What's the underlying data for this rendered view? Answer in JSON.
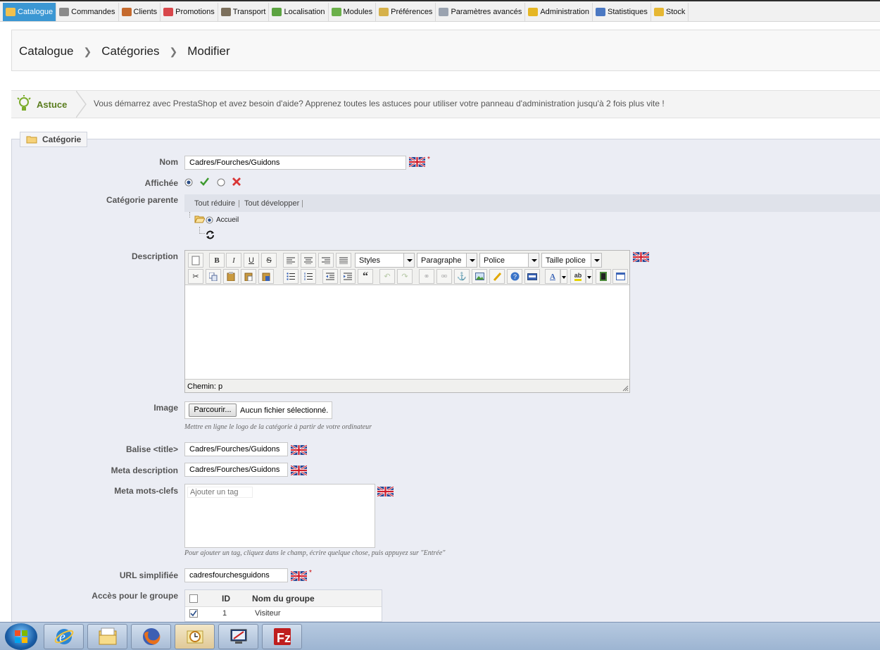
{
  "nav": {
    "tabs": [
      {
        "label": "Catalogue",
        "icon": "folder-icon",
        "color": "#f1c04d",
        "active": true
      },
      {
        "label": "Commandes",
        "icon": "cart-icon",
        "color": "#8a8a8a"
      },
      {
        "label": "Clients",
        "icon": "user-icon",
        "color": "#c56a2e"
      },
      {
        "label": "Promotions",
        "icon": "tag-icon",
        "color": "#d8474b"
      },
      {
        "label": "Transport",
        "icon": "truck-icon",
        "color": "#7b6f5c"
      },
      {
        "label": "Localisation",
        "icon": "globe-icon",
        "color": "#5ca341"
      },
      {
        "label": "Modules",
        "icon": "puzzle-icon",
        "color": "#6bb04a"
      },
      {
        "label": "Préférences",
        "icon": "settings-icon",
        "color": "#d6b14a"
      },
      {
        "label": "Paramètres avancés",
        "icon": "wrench-icon",
        "color": "#9aa3b0"
      },
      {
        "label": "Administration",
        "icon": "key-icon",
        "color": "#e5b624"
      },
      {
        "label": "Statistiques",
        "icon": "bar-chart-icon",
        "color": "#4b78c2"
      },
      {
        "label": "Stock",
        "icon": "box-icon",
        "color": "#e6b733"
      }
    ]
  },
  "breadcrumb": [
    "Catalogue",
    "Catégories",
    "Modifier"
  ],
  "tip": {
    "label": "Astuce",
    "text": "Vous démarrez avec PrestaShop et avez besoin d'aide? Apprenez toutes les astuces pour utiliser votre panneau d'administration jusqu'à 2 fois plus vite !"
  },
  "form": {
    "legend": "Catégorie",
    "name_label": "Nom",
    "name_value": "Cadres/Fourches/Guidons",
    "shown_label": "Affichée",
    "parent_label": "Catégorie parente",
    "collapse_all": "Tout réduire",
    "expand_all": "Tout développer",
    "tree_root": "Accueil",
    "description_label": "Description",
    "editor": {
      "styles": "Styles",
      "paragraph": "Paragraphe",
      "font": "Police",
      "font_size": "Taille police",
      "path": "Chemin: p"
    },
    "image_label": "Image",
    "browse_button": "Parcourir...",
    "no_file": "Aucun fichier sélectionné.",
    "image_hint": "Mettre en ligne le logo de la catégorie à partir de votre ordinateur",
    "title_label": "Balise <title>",
    "title_value": "Cadres/Fourches/Guidons",
    "meta_desc_label": "Meta description",
    "meta_desc_value": "Cadres/Fourches/Guidons",
    "meta_keywords_label": "Meta mots-clefs",
    "tag_placeholder": "Ajouter un tag",
    "tag_hint": "Pour ajouter un tag, cliquez dans le champ, écrire quelque chose, puis appuyez sur \"Entrée\"",
    "url_label": "URL simplifiée",
    "url_value": "cadresfourchesguidons",
    "group_label": "Accès pour le groupe",
    "group_table": {
      "headers": [
        "ID",
        "Nom du groupe"
      ],
      "rows": [
        {
          "id": "1",
          "name": "Visiteur",
          "checked": true
        }
      ]
    }
  },
  "taskbar": {
    "apps": [
      "internet-explorer-icon",
      "file-explorer-icon",
      "firefox-icon",
      "outlook-icon",
      "remote-desktop-icon",
      "filezilla-icon"
    ]
  }
}
